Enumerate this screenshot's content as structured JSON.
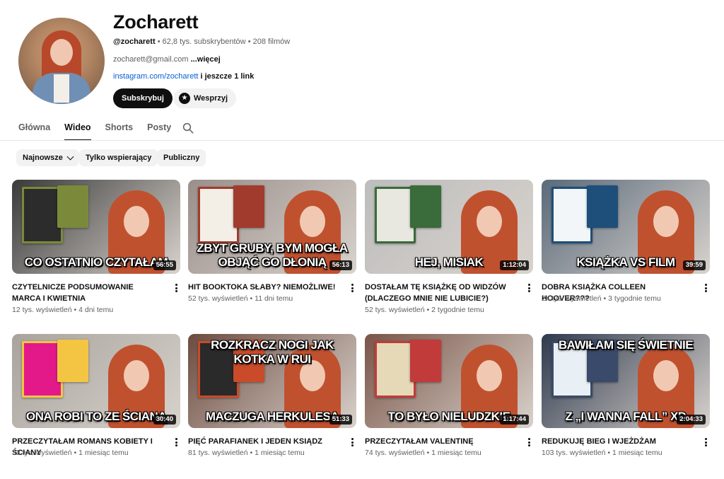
{
  "channel": {
    "name": "Zocharett",
    "handle": "@zocharett",
    "subscribers": "62,8 tys. subskrybentów",
    "videos": "208 filmów",
    "email": "zocharett@gmail.com",
    "more": "...więcej",
    "link": "instagram.com/zocharett",
    "more_links": "i jeszcze 1 link",
    "subscribe_label": "Subskrybuj",
    "support_label": "Wesprzyj"
  },
  "tabs": [
    {
      "label": "Główna",
      "active": false
    },
    {
      "label": "Wideo",
      "active": true
    },
    {
      "label": "Shorts",
      "active": false
    },
    {
      "label": "Posty",
      "active": false
    }
  ],
  "chips": {
    "sort": "Najnowsze",
    "members": "Tylko wspierający",
    "public": "Publiczny"
  },
  "videos": [
    {
      "title": "CZYTELNICZE PODSUMOWANIE MARCA I KWIETNIA",
      "views": "12 tys. wyświetleń",
      "age": "4 dni temu",
      "duration": "56:55",
      "caption": "CO OSTATNIO CZYTAŁAM",
      "bg": "#3a3a3a"
    },
    {
      "title": "HIT BOOKTOKA SŁABY? NIEMOŻLIWE!",
      "views": "52 tys. wyświetleń",
      "age": "11 dni temu",
      "duration": "56:13",
      "caption": "ZBYT GRUBY, BYM MOGŁA OBJĄĆ GO DŁONIĄ",
      "bg": "#9a8f8a"
    },
    {
      "title": "DOSTAŁAM TĘ KSIĄŻKĘ OD WIDZÓW (DLACZEGO MNIE NIE LUBICIE?)",
      "views": "52 tys. wyświetleń",
      "age": "2 tygodnie temu",
      "duration": "1:12:04",
      "caption": "HEJ, MISIAK",
      "bg": "#bdbdbd"
    },
    {
      "title": "DOBRA KSIĄŻKA COLLEEN HOOVER???",
      "views": "24 tys. wyświetleń",
      "age": "3 tygodnie temu",
      "duration": "39:59",
      "caption": "KSIĄŻKA VS FILM",
      "bg": "#5a6a7a"
    },
    {
      "title": "PRZECZYTAŁAM ROMANS KOBIETY I ŚCIANY",
      "views": "33 tys. wyświetleń",
      "age": "1 miesiąc temu",
      "duration": "30:40",
      "caption": "ONA ROBI TO ZE ŚCIANĄ",
      "bg": "#a8a39c"
    },
    {
      "title": "PIĘĆ PARAFIANEK I JEDEN KSIĄDZ",
      "views": "81 tys. wyświetleń",
      "age": "1 miesiąc temu",
      "duration": "51:33",
      "caption": "MACZUGA HERKULESA",
      "caption_top": "ROZKRACZ NOGI JAK KOTKA W RUI",
      "bg": "#6d4b3f"
    },
    {
      "title": "PRZECZYTAŁAM VALENTINĘ",
      "views": "74 tys. wyświetleń",
      "age": "1 miesiąc temu",
      "duration": "1:17:44",
      "caption": "TO BYŁO NIELUDZKIE",
      "bg": "#7a5548"
    },
    {
      "title": "REDUKUJĘ BIEG I WJEŻDŻAM",
      "views": "103 tys. wyświetleń",
      "age": "1 miesiąc temu",
      "duration": "2:04:33",
      "caption": "Z „I WANNA FALL” XD",
      "caption_top": "BAWIŁAM SIĘ ŚWIETNIE",
      "bg": "#2f3a4e"
    }
  ],
  "colors": {
    "accent": "#0f0f0f",
    "link": "#065fd4",
    "chip_bg": "#f2f2f2",
    "meta": "#606060"
  }
}
